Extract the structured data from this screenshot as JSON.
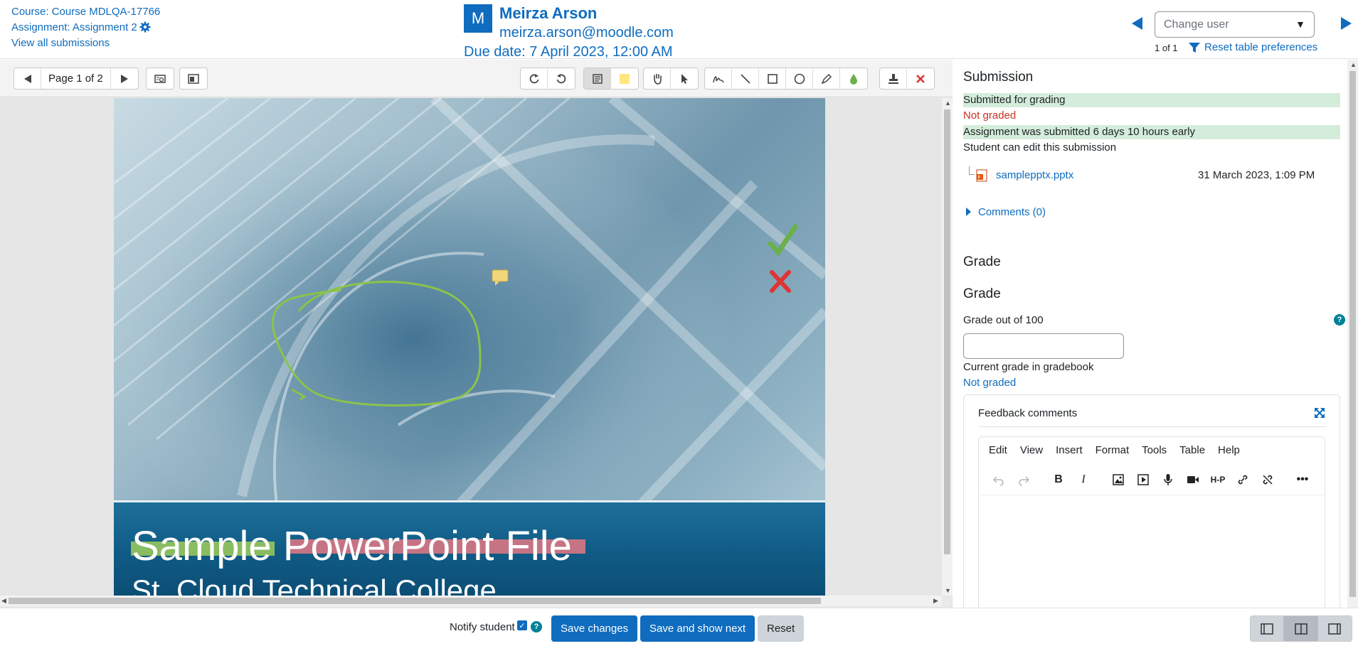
{
  "header": {
    "course_link": "Course: Course MDLQA-17766",
    "assignment_link": "Assignment: Assignment 2",
    "view_all": "View all submissions",
    "avatar_initial": "M",
    "user_name": "Meirza Arson",
    "user_email": "meirza.arson@moodle.com",
    "due_date": "Due date: 7 April 2023, 12:00 AM",
    "change_user_placeholder": "Change user",
    "pager_count": "1 of 1",
    "reset_prefs": "Reset table preferences"
  },
  "viewer": {
    "page_label": "Page 1 of 2",
    "slide_title": "Sample PowerPoint File",
    "slide_subtitle": "St. Cloud Technical College"
  },
  "grading": {
    "submission_title": "Submission",
    "status_submitted": "Submitted for grading",
    "status_graded": "Not graded",
    "status_early": "Assignment was submitted 6 days 10 hours early",
    "status_edit": "Student can edit this submission",
    "file_name": "samplepptx.pptx",
    "file_date": "31 March 2023, 1:09 PM",
    "comments_label": "Comments (0)",
    "grade_section_title": "Grade",
    "grade_title": "Grade",
    "grade_out_of": "Grade out of 100",
    "grade_value": "",
    "current_grade_label": "Current grade in gradebook",
    "current_grade_value": "Not graded",
    "feedback_title": "Feedback comments",
    "editor_menu": [
      "Edit",
      "View",
      "Insert",
      "Format",
      "Tools",
      "Table",
      "Help"
    ],
    "help_badge": "?"
  },
  "footer": {
    "notify_label": "Notify student",
    "save_changes": "Save changes",
    "save_next": "Save and show next",
    "reset": "Reset"
  },
  "colors": {
    "brand": "#0f6cbf",
    "success_bg": "#d4edda",
    "danger": "#ca3120",
    "help": "#008196"
  }
}
